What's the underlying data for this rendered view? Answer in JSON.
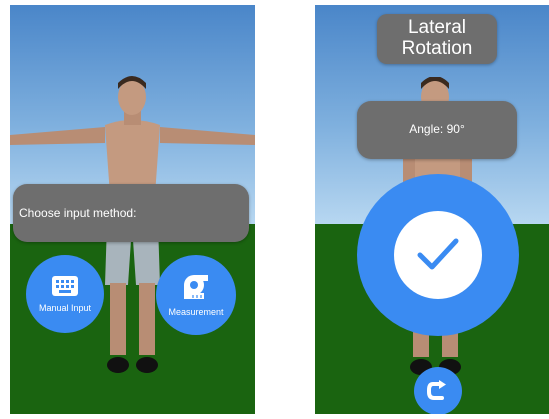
{
  "left_screen": {
    "prompt": "Choose input method:",
    "manual_button": {
      "label": "Manual Input",
      "icon": "keyboard-icon"
    },
    "measurement_button": {
      "label": "Measurement",
      "icon": "tape-measure-icon"
    }
  },
  "right_screen": {
    "title_line1": "Lateral",
    "title_line2": "Rotation",
    "angle_text": "Angle: 90°",
    "confirm_icon": "checkmark-icon",
    "reset_icon": "rotate-icon"
  },
  "colors": {
    "accent": "#3a8bf2",
    "panel": "#6e6e6e",
    "ground": "#1a6410",
    "sky": "#7fb0de"
  }
}
